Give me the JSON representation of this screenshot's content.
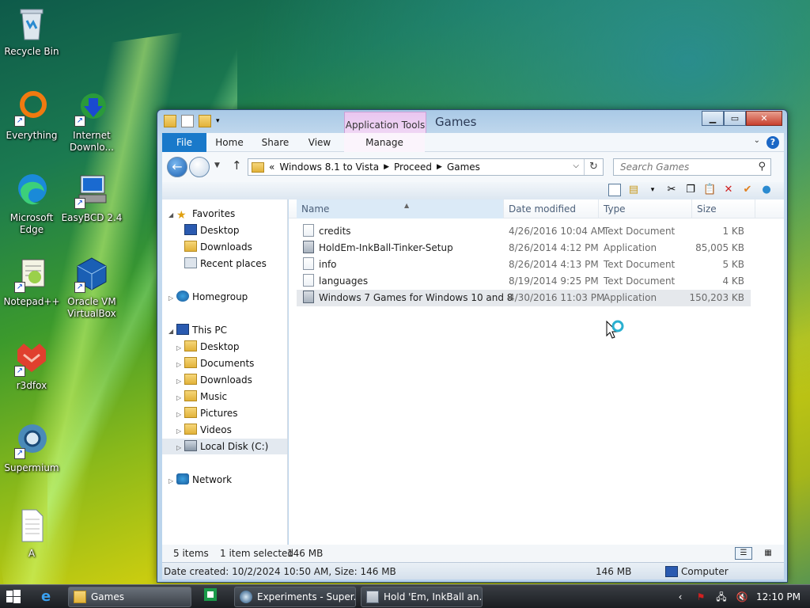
{
  "desktop": {
    "icons": [
      {
        "label": "Recycle Bin"
      },
      {
        "label": "Everything"
      },
      {
        "label": "Internet Downlo..."
      },
      {
        "label": "Microsoft Edge"
      },
      {
        "label": "EasyBCD 2.4"
      },
      {
        "label": "Notepad++"
      },
      {
        "label": "Oracle VM VirtualBox"
      },
      {
        "label": "r3dfox"
      },
      {
        "label": "Supermium"
      },
      {
        "label": "A"
      }
    ]
  },
  "window": {
    "title": "Games",
    "context_tab": "Application Tools",
    "ribbon_tabs": [
      "File",
      "Home",
      "Share",
      "View",
      "Manage"
    ],
    "address": {
      "overflow": "«",
      "segments": [
        "Windows 8.1 to Vista",
        "Proceed",
        "Games"
      ]
    },
    "search_placeholder": "Search Games",
    "nav": {
      "favorites": "Favorites",
      "fav_items": [
        "Desktop",
        "Downloads",
        "Recent places"
      ],
      "homegroup": "Homegroup",
      "thispc": "This PC",
      "pc_items": [
        "Desktop",
        "Documents",
        "Downloads",
        "Music",
        "Pictures",
        "Videos",
        "Local Disk (C:)"
      ],
      "network": "Network"
    },
    "columns": {
      "name": "Name",
      "date": "Date modified",
      "type": "Type",
      "size": "Size"
    },
    "files": [
      {
        "name": "credits",
        "date": "4/26/2016 10:04 AM",
        "type": "Text Document",
        "size": "1 KB"
      },
      {
        "name": "HoldEm-InkBall-Tinker-Setup",
        "date": "8/26/2014 4:12 PM",
        "type": "Application",
        "size": "85,005 KB"
      },
      {
        "name": "info",
        "date": "8/26/2014 4:13 PM",
        "type": "Text Document",
        "size": "5 KB"
      },
      {
        "name": "languages",
        "date": "8/19/2014 9:25 PM",
        "type": "Text Document",
        "size": "4 KB"
      },
      {
        "name": "Windows 7 Games for Windows 10 and 8",
        "date": "4/30/2016 11:03 PM",
        "type": "Application",
        "size": "150,203 KB"
      }
    ],
    "status": {
      "items": "5 items",
      "selected": "1 item selected",
      "selected_size": "146 MB"
    },
    "details": {
      "info": "Date created: 10/2/2024 10:50 AM, Size: 146 MB",
      "size": "146 MB",
      "location": "Computer"
    }
  },
  "taskbar": {
    "tasks": [
      "Games",
      "Experiments - Super...",
      "Hold 'Em, InkBall an..."
    ],
    "clock": "12:10 PM"
  }
}
